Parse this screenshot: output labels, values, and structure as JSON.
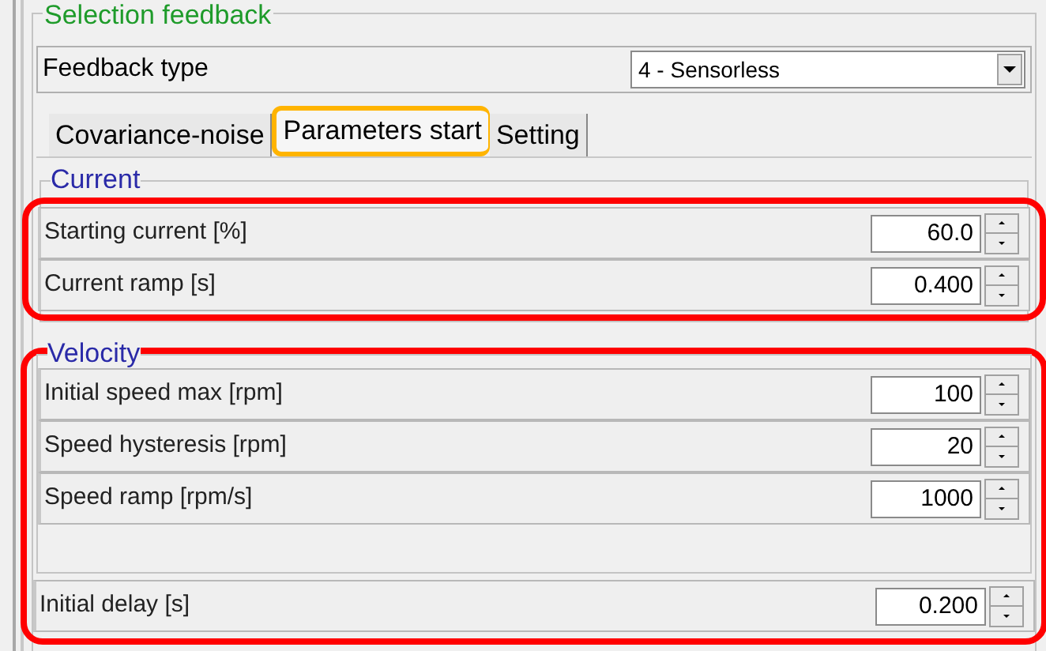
{
  "group_title": "Selection feedback",
  "feedback_type": {
    "label": "Feedback type",
    "value": "4 - Sensorless"
  },
  "tabs": [
    {
      "label": "Covariance-noise",
      "selected": false,
      "highlighted": false
    },
    {
      "label": "Parameters start",
      "selected": true,
      "highlighted": true
    },
    {
      "label": "Setting",
      "selected": false,
      "highlighted": false
    }
  ],
  "current": {
    "title": "Current",
    "highlighted": true,
    "rows": [
      {
        "label": "Starting current [%]",
        "value": "60.0"
      },
      {
        "label": "Current ramp [s]",
        "value": "0.400"
      }
    ]
  },
  "velocity": {
    "title": "Velocity",
    "highlighted": true,
    "rows": [
      {
        "label": "Initial speed max [rpm]",
        "value": "100"
      },
      {
        "label": "Speed hysteresis [rpm]",
        "value": "20"
      },
      {
        "label": "Speed ramp [rpm/s]",
        "value": "1000"
      }
    ],
    "extra_row": {
      "label": "Initial delay [s]",
      "value": "0.200"
    }
  }
}
